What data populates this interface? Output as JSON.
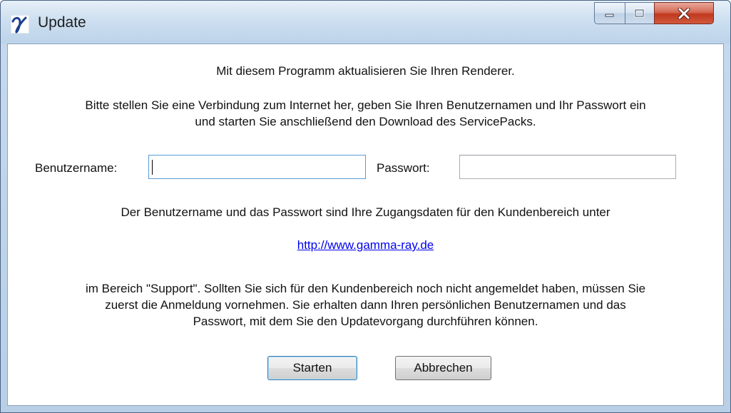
{
  "window": {
    "title": "Update",
    "controls": {
      "minimize": "minimize-icon",
      "maximize": "maximize-icon",
      "close": "close-icon"
    }
  },
  "content": {
    "intro": "Mit diesem Programm aktualisieren Sie Ihren Renderer.",
    "instructions_line1": "Bitte stellen Sie eine Verbindung zum Internet her, geben Sie Ihren Benutzernamen und Ihr Passwort ein",
    "instructions_line2": "und starten Sie anschließend den Download des ServicePacks.",
    "username_label": "Benutzername:",
    "username_value": "",
    "password_label": "Passwort:",
    "password_value": "",
    "credentials_note": "Der Benutzername und das Passwort sind Ihre Zugangsdaten für den Kundenbereich unter",
    "link": "http://www.gamma-ray.de",
    "support_line1": "im Bereich \"Support\". Sollten Sie sich für den Kundenbereich noch nicht angemeldet haben, müssen Sie",
    "support_line2": "zuerst die Anmeldung vornehmen. Sie erhalten dann Ihren persönlichen Benutzernamen und das",
    "support_line3": "Passwort, mit dem Sie den Updatevorgang durchführen können."
  },
  "buttons": {
    "start": "Starten",
    "cancel": "Abbrechen"
  },
  "colors": {
    "link": "#0000ee",
    "close_button": "#c0391f",
    "title_bar": "#cddff0"
  }
}
